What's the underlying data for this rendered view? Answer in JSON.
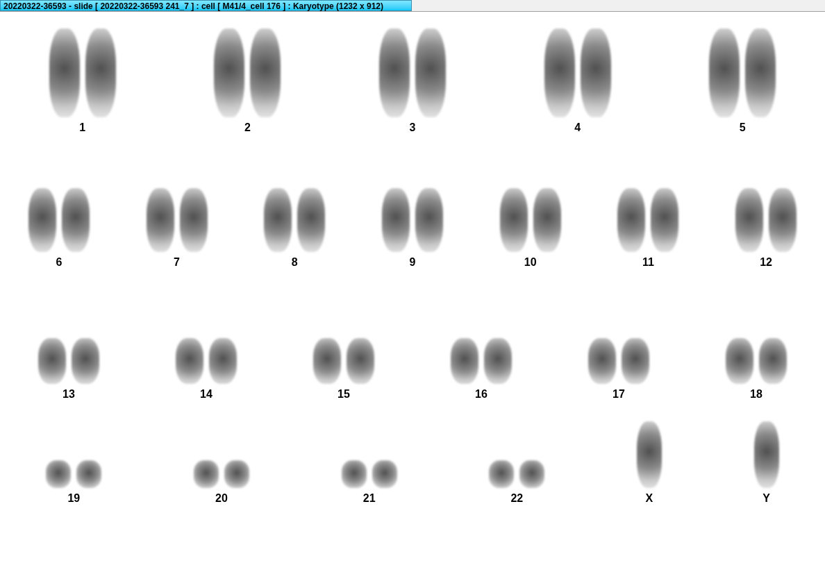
{
  "window": {
    "title": "20220322-36593 - slide [ 20220322-36593 241_7 ] : cell [ M41/4_cell 176 ] : Karyotype  (1232 x 912)"
  },
  "rows": [
    {
      "pairs": [
        {
          "label": "1",
          "kind": "pair"
        },
        {
          "label": "2",
          "kind": "pair"
        },
        {
          "label": "3",
          "kind": "pair"
        },
        {
          "label": "4",
          "kind": "pair"
        },
        {
          "label": "5",
          "kind": "pair"
        }
      ]
    },
    {
      "pairs": [
        {
          "label": "6",
          "kind": "pair"
        },
        {
          "label": "7",
          "kind": "pair"
        },
        {
          "label": "8",
          "kind": "pair"
        },
        {
          "label": "9",
          "kind": "pair"
        },
        {
          "label": "10",
          "kind": "pair"
        },
        {
          "label": "11",
          "kind": "pair"
        },
        {
          "label": "12",
          "kind": "pair"
        }
      ]
    },
    {
      "pairs": [
        {
          "label": "13",
          "kind": "pair"
        },
        {
          "label": "14",
          "kind": "pair"
        },
        {
          "label": "15",
          "kind": "pair"
        },
        {
          "label": "16",
          "kind": "pair"
        },
        {
          "label": "17",
          "kind": "pair"
        },
        {
          "label": "18",
          "kind": "pair"
        }
      ]
    },
    {
      "pairs": [
        {
          "label": "19",
          "kind": "pair"
        },
        {
          "label": "20",
          "kind": "pair"
        },
        {
          "label": "21",
          "kind": "pair"
        },
        {
          "label": "22",
          "kind": "pair"
        },
        {
          "label": "X",
          "kind": "single"
        },
        {
          "label": "Y",
          "kind": "single"
        }
      ]
    }
  ]
}
